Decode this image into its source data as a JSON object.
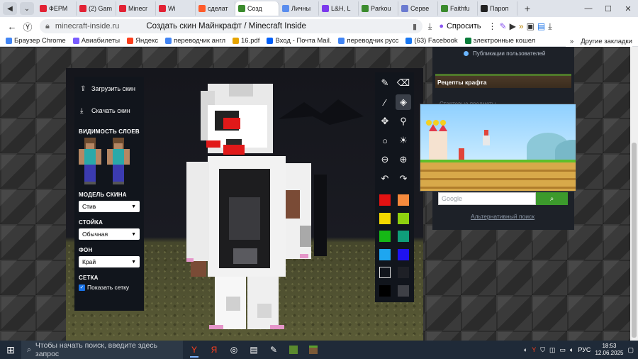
{
  "browser": {
    "tabs": [
      {
        "title": "ФЕРМ",
        "color": "#e22134"
      },
      {
        "title": "(2) Gam",
        "color": "#e22134"
      },
      {
        "title": "Minecr",
        "color": "#e22134"
      },
      {
        "title": "Wi",
        "color": "#e22134"
      },
      {
        "title": "сделат",
        "color": "#ff5b2b"
      },
      {
        "title": "Созд",
        "color": "#3b8b2e",
        "active": true
      },
      {
        "title": "Личны",
        "color": "#5a8dee"
      },
      {
        "title": "L&H, L",
        "color": "#7c3aed"
      },
      {
        "title": "Parkou",
        "color": "#3b8b2e"
      },
      {
        "title": "Серве",
        "color": "#6b7bd1"
      },
      {
        "title": "Faithfu",
        "color": "#3b8b2e"
      },
      {
        "title": "Пароп",
        "color": "#222222"
      }
    ],
    "url_host": "minecraft-inside.ru",
    "page_title": "Создать скин Майнкрафт / Minecraft Inside",
    "ask_label": "Спросить",
    "bookmarks": [
      {
        "label": "Браузер Chrome",
        "color": "#4285f4"
      },
      {
        "label": "Авиабилеты",
        "color": "#7a5cff"
      },
      {
        "label": "Яндекс",
        "color": "#fc3f1d"
      },
      {
        "label": "переводчик англ",
        "color": "#4285f4"
      },
      {
        "label": "16.pdf",
        "color": "#e6a400"
      },
      {
        "label": "Вход - Почта Mail.",
        "color": "#005ff9"
      },
      {
        "label": "переводчик русс",
        "color": "#4285f4"
      },
      {
        "label": "(63) Facebook",
        "color": "#1877f2"
      },
      {
        "label": "электронные кошел",
        "color": "#0a7d3b"
      }
    ],
    "bookmarks_more": "»",
    "other_bookmarks": "Другие закладки"
  },
  "editor": {
    "upload_label": "Загрузить скин",
    "download_label": "Скачать скин",
    "layers_heading": "ВИДИМОСТЬ СЛОЕВ",
    "model_heading": "МОДЕЛЬ СКИНА",
    "model_value": "Стив",
    "stance_heading": "СТОЙКА",
    "stance_value": "Обычная",
    "bg_heading": "ФОН",
    "bg_value": "Край",
    "grid_heading": "СЕТКА",
    "grid_label": "Показать сетку",
    "grid_checked": true,
    "palette": [
      "#e31212",
      "#f58a3d",
      "#f5d900",
      "#8fd10f",
      "#16b816",
      "#0f9e7a",
      "#1ea6f0",
      "#1f12f0",
      "outline",
      "#1e2026",
      "#000000",
      "#3e4046"
    ]
  },
  "sidebar": {
    "user_posts": "Публикации пользователей",
    "recipes": "Рецепты крафта",
    "hidden_line": "Стартовые предметы",
    "google_placeholder": "Google",
    "alt_search": "Альтернативный поиск"
  },
  "taskbar": {
    "search_placeholder": "Чтобы начать поиск, введите здесь запрос",
    "lang": "РУС",
    "time": "18:53",
    "date": "12.06.2025"
  }
}
